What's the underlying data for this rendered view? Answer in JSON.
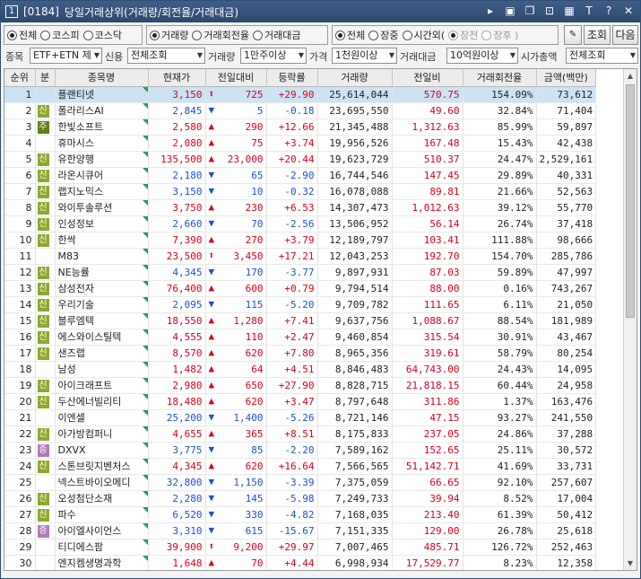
{
  "window": {
    "num": "1",
    "code": "[0184]",
    "title": "당일거래상위(거래량/회전율/거래대금)"
  },
  "titlebar_icons": [
    "arrow-icon",
    "m-box-icon",
    "window-icon",
    "link-icon",
    "grid-icon",
    "text-icon",
    "help-icon",
    "close-icon"
  ],
  "market_radios": [
    {
      "label": "전체",
      "on": true
    },
    {
      "label": "코스피",
      "on": false
    },
    {
      "label": "코스닥",
      "on": false
    }
  ],
  "sort_radios": [
    {
      "label": "거래량",
      "on": true
    },
    {
      "label": "거래회전율",
      "on": false
    },
    {
      "label": "거래대금",
      "on": false
    }
  ],
  "session_radios": [
    {
      "label": "전체",
      "on": true,
      "dim": false
    },
    {
      "label": "장중",
      "on": false,
      "dim": false
    },
    {
      "label": "시간외(",
      "on": false,
      "dim": false
    },
    {
      "label": "장전",
      "on": true,
      "dim": true
    },
    {
      "label": "장후 )",
      "on": false,
      "dim": true
    }
  ],
  "buttons": {
    "search": "조회",
    "next": "다음"
  },
  "filters": {
    "stock_label": "종목",
    "stock_value": "ETF+ETN 제",
    "credit_label": "신용",
    "credit_value": "전체조회",
    "volume_label": "거래량",
    "volume_value": "1만주이상",
    "price_label": "가격",
    "price_value": "1천원이상",
    "amount_label": "거래대금",
    "amount_value": "10억원이상",
    "cap_label": "시가총액",
    "cap_value": "전체조회"
  },
  "columns": [
    "순위",
    "분",
    "종목명",
    "현재가",
    "전일대비",
    "등락률",
    "거래량",
    "전일비",
    "거래회전율",
    "금액(백만)"
  ],
  "rows": [
    {
      "rank": "1",
      "badge": "",
      "name": "플랜티넷",
      "price": "3,150",
      "dir": "upper",
      "chg": "725",
      "rate": "+29.90",
      "vol": "25,614,044",
      "prev": "570.75",
      "turn": "154.09%",
      "amt": "73,612",
      "selected": true
    },
    {
      "rank": "2",
      "badge": "신",
      "name": "폴라리스AI",
      "price": "2,845",
      "dir": "down",
      "chg": "5",
      "rate": "-0.18",
      "vol": "23,695,550",
      "prev": "49.60",
      "turn": "32.84%",
      "amt": "71,404"
    },
    {
      "rank": "3",
      "badge": "주",
      "name": "한빛소프트",
      "price": "2,580",
      "dir": "up",
      "chg": "290",
      "rate": "+12.66",
      "vol": "21,345,488",
      "prev": "1,312.63",
      "turn": "85.99%",
      "amt": "59,897"
    },
    {
      "rank": "4",
      "badge": "",
      "name": "휴마시스",
      "price": "2,080",
      "dir": "up",
      "chg": "75",
      "rate": "+3.74",
      "vol": "19,956,526",
      "prev": "167.48",
      "turn": "15.43%",
      "amt": "42,438"
    },
    {
      "rank": "5",
      "badge": "신",
      "name": "유한양행",
      "price": "135,500",
      "dir": "up",
      "chg": "23,000",
      "rate": "+20.44",
      "vol": "19,623,729",
      "prev": "510.37",
      "turn": "24.47%",
      "amt": "2,529,161"
    },
    {
      "rank": "6",
      "badge": "신",
      "name": "라온시큐어",
      "price": "2,180",
      "dir": "down",
      "chg": "65",
      "rate": "-2.90",
      "vol": "16,744,546",
      "prev": "147.45",
      "turn": "29.89%",
      "amt": "40,331"
    },
    {
      "rank": "7",
      "badge": "신",
      "name": "랩지노믹스",
      "price": "3,150",
      "dir": "down",
      "chg": "10",
      "rate": "-0.32",
      "vol": "16,078,088",
      "prev": "89.81",
      "turn": "21.66%",
      "amt": "52,563"
    },
    {
      "rank": "8",
      "badge": "신",
      "name": "와이투솔루션",
      "price": "3,750",
      "dir": "up",
      "chg": "230",
      "rate": "+6.53",
      "vol": "14,307,473",
      "prev": "1,012.63",
      "turn": "39.12%",
      "amt": "55,770"
    },
    {
      "rank": "9",
      "badge": "신",
      "name": "인성정보",
      "price": "2,660",
      "dir": "down",
      "chg": "70",
      "rate": "-2.56",
      "vol": "13,506,952",
      "prev": "56.14",
      "turn": "26.74%",
      "amt": "37,418"
    },
    {
      "rank": "10",
      "badge": "신",
      "name": "한싹",
      "price": "7,390",
      "dir": "up",
      "chg": "270",
      "rate": "+3.79",
      "vol": "12,189,797",
      "prev": "103.41",
      "turn": "111.88%",
      "amt": "98,666"
    },
    {
      "rank": "11",
      "badge": "",
      "name": "M83",
      "price": "23,500",
      "dir": "upper",
      "chg": "3,450",
      "rate": "+17.21",
      "vol": "12,043,253",
      "prev": "192.70",
      "turn": "154.70%",
      "amt": "285,786"
    },
    {
      "rank": "12",
      "badge": "신",
      "name": "NE능률",
      "price": "4,345",
      "dir": "down",
      "chg": "170",
      "rate": "-3.77",
      "vol": "9,897,931",
      "prev": "87.03",
      "turn": "59.89%",
      "amt": "47,997"
    },
    {
      "rank": "13",
      "badge": "신",
      "name": "삼성전자",
      "price": "76,400",
      "dir": "up",
      "chg": "600",
      "rate": "+0.79",
      "vol": "9,794,514",
      "prev": "88.00",
      "turn": "0.16%",
      "amt": "743,267"
    },
    {
      "rank": "14",
      "badge": "신",
      "name": "우리기술",
      "price": "2,095",
      "dir": "down",
      "chg": "115",
      "rate": "-5.20",
      "vol": "9,709,782",
      "prev": "111.65",
      "turn": "6.11%",
      "amt": "21,050"
    },
    {
      "rank": "15",
      "badge": "신",
      "name": "블루엠텍",
      "price": "18,550",
      "dir": "up",
      "chg": "1,280",
      "rate": "+7.41",
      "vol": "9,637,756",
      "prev": "1,088.67",
      "turn": "88.54%",
      "amt": "181,989"
    },
    {
      "rank": "16",
      "badge": "신",
      "name": "에스와이스틸텍",
      "price": "4,555",
      "dir": "up",
      "chg": "110",
      "rate": "+2.47",
      "vol": "9,460,854",
      "prev": "315.54",
      "turn": "30.91%",
      "amt": "43,467"
    },
    {
      "rank": "17",
      "badge": "신",
      "name": "샌즈랩",
      "price": "8,570",
      "dir": "up",
      "chg": "620",
      "rate": "+7.80",
      "vol": "8,965,356",
      "prev": "319.61",
      "turn": "58.79%",
      "amt": "80,254"
    },
    {
      "rank": "18",
      "badge": "",
      "name": "남성",
      "price": "1,482",
      "dir": "up",
      "chg": "64",
      "rate": "+4.51",
      "vol": "8,846,483",
      "prev": "64,743.00",
      "turn": "24.43%",
      "amt": "14,095"
    },
    {
      "rank": "19",
      "badge": "신",
      "name": "아이크래프트",
      "price": "2,980",
      "dir": "up",
      "chg": "650",
      "rate": "+27.90",
      "vol": "8,828,715",
      "prev": "21,818.15",
      "turn": "60.44%",
      "amt": "24,958"
    },
    {
      "rank": "20",
      "badge": "신",
      "name": "두산에너빌리티",
      "price": "18,480",
      "dir": "up",
      "chg": "620",
      "rate": "+3.47",
      "vol": "8,797,648",
      "prev": "311.86",
      "turn": "1.37%",
      "amt": "163,476"
    },
    {
      "rank": "21",
      "badge": "",
      "name": "이엔셀",
      "price": "25,200",
      "dir": "down",
      "chg": "1,400",
      "rate": "-5.26",
      "vol": "8,721,146",
      "prev": "47.15",
      "turn": "93.27%",
      "amt": "241,550"
    },
    {
      "rank": "22",
      "badge": "신",
      "name": "아가방컴퍼니",
      "price": "4,655",
      "dir": "up",
      "chg": "365",
      "rate": "+8.51",
      "vol": "8,175,833",
      "prev": "237.05",
      "turn": "24.86%",
      "amt": "37,288"
    },
    {
      "rank": "23",
      "badge": "증",
      "name": "DXVX",
      "price": "3,775",
      "dir": "down",
      "chg": "85",
      "rate": "-2.20",
      "vol": "7,589,162",
      "prev": "152.65",
      "turn": "25.11%",
      "amt": "30,572"
    },
    {
      "rank": "24",
      "badge": "신",
      "name": "스톤브릿지벤처스",
      "price": "4,345",
      "dir": "up",
      "chg": "620",
      "rate": "+16.64",
      "vol": "7,566,565",
      "prev": "51,142.71",
      "turn": "41.69%",
      "amt": "33,731"
    },
    {
      "rank": "25",
      "badge": "",
      "name": "넥스트바이오메디",
      "price": "32,800",
      "dir": "down",
      "chg": "1,150",
      "rate": "-3.39",
      "vol": "7,375,059",
      "prev": "66.65",
      "turn": "92.10%",
      "amt": "257,607"
    },
    {
      "rank": "26",
      "badge": "신",
      "name": "오성첨단소재",
      "price": "2,280",
      "dir": "down",
      "chg": "145",
      "rate": "-5.98",
      "vol": "7,249,733",
      "prev": "39.94",
      "turn": "8.52%",
      "amt": "17,004"
    },
    {
      "rank": "27",
      "badge": "신",
      "name": "파수",
      "price": "6,520",
      "dir": "down",
      "chg": "330",
      "rate": "-4.82",
      "vol": "7,168,035",
      "prev": "213.40",
      "turn": "61.39%",
      "amt": "50,412"
    },
    {
      "rank": "28",
      "badge": "증",
      "name": "아이엘사이언스",
      "price": "3,310",
      "dir": "down",
      "chg": "615",
      "rate": "-15.67",
      "vol": "7,151,335",
      "prev": "129.00",
      "turn": "26.78%",
      "amt": "25,618"
    },
    {
      "rank": "29",
      "badge": "",
      "name": "티디에스팜",
      "price": "39,900",
      "dir": "upper",
      "chg": "9,200",
      "rate": "+29.97",
      "vol": "7,007,465",
      "prev": "485.71",
      "turn": "126.72%",
      "amt": "252,463"
    },
    {
      "rank": "30",
      "badge": "",
      "name": "엔지켐생명과학",
      "price": "1,648",
      "dir": "up",
      "chg": "70",
      "rate": "+4.44",
      "vol": "6,998,934",
      "prev": "17,529.77",
      "turn": "8.23%",
      "amt": "12,358"
    }
  ]
}
